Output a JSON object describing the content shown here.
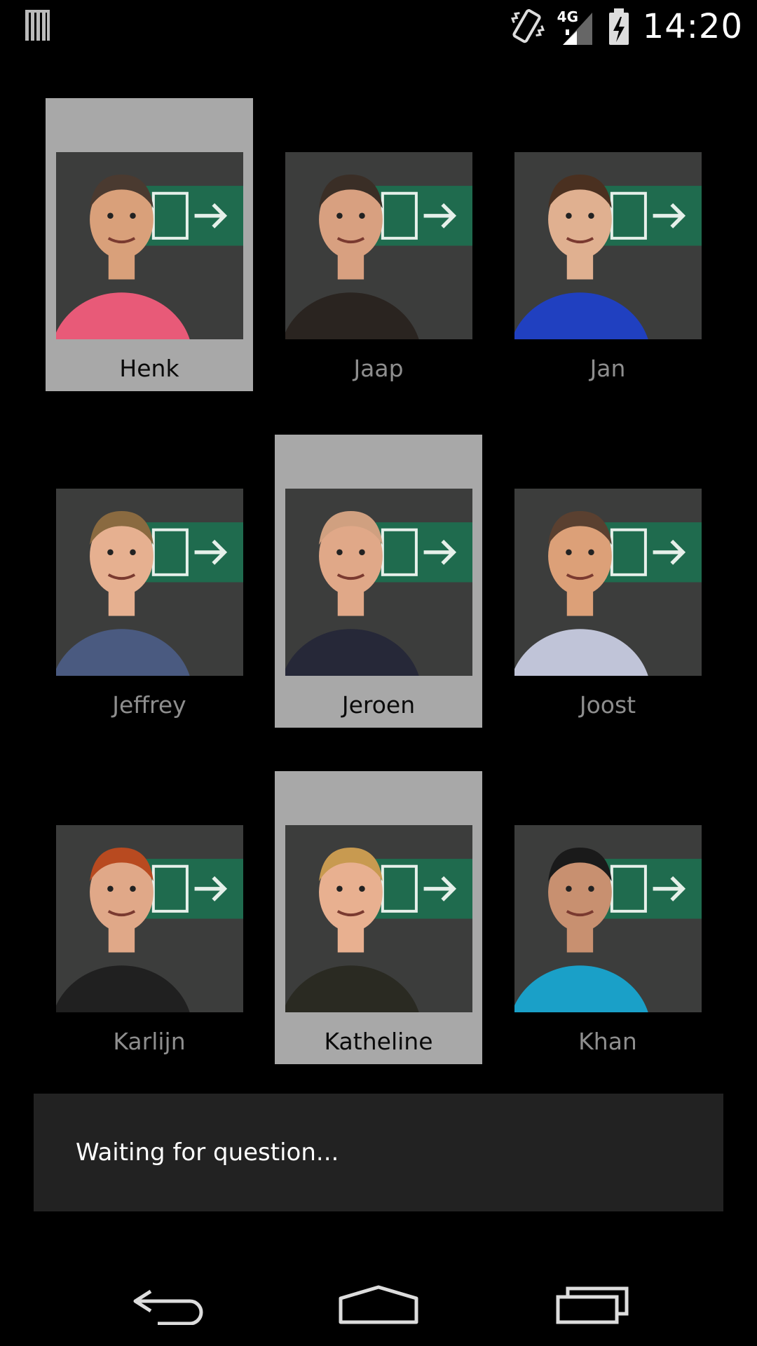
{
  "status_bar": {
    "left_icon": "barcode-notification-icon",
    "icons": [
      "vibrate-icon",
      "signal-4g-icon",
      "battery-charging-icon"
    ],
    "network_label": "4G",
    "time": "14:20"
  },
  "colors": {
    "background": "#000000",
    "selected_tile": "#a8a8a8",
    "unselected_name": "#8e8e8e",
    "selected_name": "#0a0a0a",
    "message_bg": "#222222"
  },
  "people": [
    {
      "name": "Henk",
      "selected": true,
      "shirt": "#e85a78",
      "skin": "#d9a07a",
      "hair": "#4a3a30"
    },
    {
      "name": "Jaap",
      "selected": false,
      "shirt": "#2a2420",
      "skin": "#d8a080",
      "hair": "#3a2e26"
    },
    {
      "name": "Jan",
      "selected": false,
      "shirt": "#2040c0",
      "skin": "#e0b090",
      "hair": "#4a3020"
    },
    {
      "name": "Jeffrey",
      "selected": false,
      "shirt": "#4a5a80",
      "skin": "#e6b090",
      "hair": "#8a6a40"
    },
    {
      "name": "Jeroen",
      "selected": true,
      "shirt": "#262838",
      "skin": "#e0a888",
      "hair": "#d0a080"
    },
    {
      "name": "Joost",
      "selected": false,
      "shirt": "#c0c4d8",
      "skin": "#dca078",
      "hair": "#5a4030"
    },
    {
      "name": "Karlijn",
      "selected": false,
      "shirt": "#202020",
      "skin": "#e0a888",
      "hair": "#b84a20"
    },
    {
      "name": "Katheline",
      "selected": true,
      "shirt": "#2a2a22",
      "skin": "#e8b090",
      "hair": "#c89a50"
    },
    {
      "name": "Khan",
      "selected": false,
      "shirt": "#1aa0c8",
      "skin": "#c89070",
      "hair": "#1a1a1a"
    }
  ],
  "message": {
    "text": "Waiting for question..."
  },
  "nav": {
    "back": "back-icon",
    "home": "home-icon",
    "recents": "recents-icon"
  }
}
